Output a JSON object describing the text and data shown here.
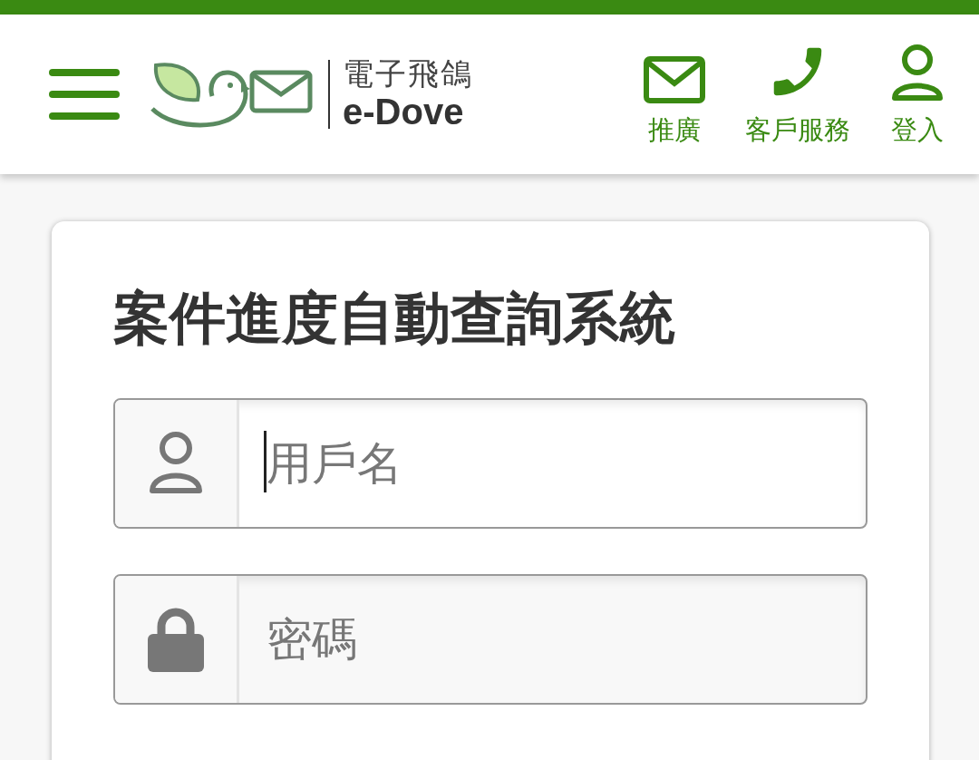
{
  "header": {
    "logo": {
      "name": "電子飛鴿",
      "latin": "e-Dove"
    },
    "nav": [
      {
        "kind": "mail",
        "label": "推廣"
      },
      {
        "kind": "phone",
        "label": "客戶服務"
      },
      {
        "kind": "user",
        "label": "登入"
      }
    ]
  },
  "login": {
    "title": "案件進度自動查詢系統",
    "fields": [
      {
        "kind": "user",
        "placeholder": "用戶名",
        "focused": true
      },
      {
        "kind": "lock",
        "placeholder": "密碼",
        "focused": false
      }
    ]
  }
}
